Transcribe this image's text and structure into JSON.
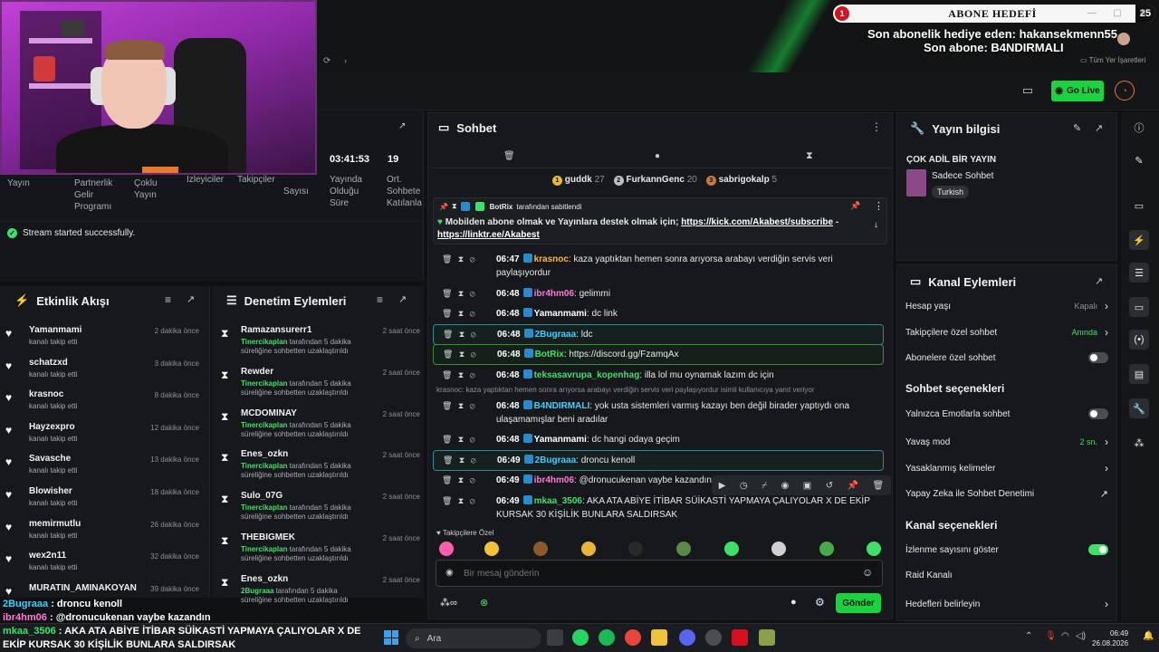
{
  "overlay": {
    "goal_title": "ABONE HEDEFİ",
    "goal_current": "1",
    "goal_target": "25",
    "last_gift": "Son abonelik hediye eden: hakansekmenn55",
    "last_sub": "Son abone: B4NDIRMALI",
    "bookmarks": "Tüm Yer İşaretleri"
  },
  "navbar": {
    "go_live": "Go Live"
  },
  "stats": {
    "time_value": "03:41:53",
    "count_value": "19",
    "labels": [
      "Yayın",
      "Partnerlik Gelir Programı",
      "Çoklu Yayın",
      "İzleyiciler",
      "Takipçiler",
      "Sayısı",
      "Yayında Olduğu Süre",
      "Ort. Sohbete Katılanla"
    ],
    "toast": "Stream started successfully."
  },
  "activity": {
    "title": "Etkinlik Akışı",
    "items": [
      {
        "name": "Yamanmami",
        "sub": "kanalı takip etti",
        "time": "2 dakika önce"
      },
      {
        "name": "schatzxd",
        "sub": "kanalı takip etti",
        "time": "3 dakika önce"
      },
      {
        "name": "krasnoc",
        "sub": "kanalı takip etti",
        "time": "8 dakika önce"
      },
      {
        "name": "Hayzexpro",
        "sub": "kanalı takip etti",
        "time": "12 dakika önce"
      },
      {
        "name": "Savasche",
        "sub": "kanalı takip etti",
        "time": "13 dakika önce"
      },
      {
        "name": "Blowisher",
        "sub": "kanalı takip etti",
        "time": "18 dakika önce"
      },
      {
        "name": "memirmutlu",
        "sub": "kanalı takip etti",
        "time": "26 dakika önce"
      },
      {
        "name": "wex2n11",
        "sub": "kanalı takip etti",
        "time": "32 dakika önce"
      },
      {
        "name": "MURATIN_AMINAKOYAN",
        "sub": "",
        "time": "39 dakika önce"
      }
    ]
  },
  "moderation": {
    "title": "Denetim Eylemleri",
    "items": [
      {
        "name": "Ramazansurerr1",
        "by": "Tinercikaplan",
        "action": "tarafından 5 dakika süreliğine sohbetten uzaklaştırıldı",
        "time": "2 saat önce"
      },
      {
        "name": "Rewder",
        "by": "Tinercikaplan",
        "action": "tarafından 5 dakika süreliğine sohbetten uzaklaştırıldı",
        "time": "2 saat önce"
      },
      {
        "name": "MCDOMINAY",
        "by": "Tinercikaplan",
        "action": "tarafından 5 dakika süreliğine sohbetten uzaklaştırıldı",
        "time": "2 saat önce"
      },
      {
        "name": "Enes_ozkn",
        "by": "Tinercikaplan",
        "action": "tarafından 5 dakika süreliğine sohbetten uzaklaştırıldı",
        "time": "2 saat önce"
      },
      {
        "name": "Sulo_07G",
        "by": "Tinercikaplan",
        "action": "tarafından 5 dakika süreliğine sohbetten uzaklaştırıldı",
        "time": "2 saat önce"
      },
      {
        "name": "THEBIGMEK",
        "by": "Tinercikaplan",
        "action": "tarafından 5 dakika süreliğine sohbetten uzaklaştırıldı",
        "time": "2 saat önce"
      },
      {
        "name": "Enes_ozkn",
        "by": "2Bugraaa",
        "action": "tarafından 5 dakika süreliğine sohbetten uzaklaştırıldı",
        "time": "2 saat önce"
      }
    ]
  },
  "overlay_chat": [
    {
      "name": "2Bugraaa",
      "sep": " : ",
      "text": "droncu kenoll",
      "color": "#3fd0ff"
    },
    {
      "name": "ibr4hm06",
      "sep": " : ",
      "text": "@dronucukenan vaybe kazandın",
      "color": "#ff79d9"
    },
    {
      "name": "mkaa_3506",
      "sep": " : ",
      "text": "AKA ATA ABİYE İTİBAR SÜİKASTİ YAPMAYA ÇALIYOLAR X DE",
      "color": "#3fe06a"
    },
    {
      "name": "",
      "sep": "",
      "text": "EKİP KURSAK 30 KİŞİLİK BUNLARA SALDIRSAK",
      "color": "#ffffff"
    }
  ],
  "chat": {
    "title": "Sohbet",
    "gifters": [
      {
        "rank": "1",
        "name": "guddk",
        "count": "27"
      },
      {
        "rank": "2",
        "name": "FurkannGenc",
        "count": "20"
      },
      {
        "rank": "3",
        "name": "sabrigokalp",
        "count": "5"
      }
    ],
    "pinned": {
      "by": "BotRix",
      "by_suffix": "tarafından sabitlendi",
      "text": "Mobilden abone olmak ve Yayınlara destek olmak için;",
      "link1": "https://kick.com/Akabest/subscribe",
      "dash": "-",
      "link2": "https://linktr.ee/Akabest"
    },
    "messages": [
      {
        "time": "06:47",
        "name": "krasnoc",
        "color": "#ffb640",
        "text": "kaza yaptıktan hemen sonra arıyorsa arabayı verdiğin servis veri paylaşıyordur",
        "hl": ""
      },
      {
        "time": "06:48",
        "name": "ibr4hm06",
        "color": "#ff79d9",
        "text": "gelimmi",
        "hl": ""
      },
      {
        "time": "06:48",
        "name": "Yamanmami",
        "color": "#ffffff",
        "text": "dc link",
        "hl": ""
      },
      {
        "time": "06:48",
        "name": "2Bugraaa",
        "color": "#3fd0ff",
        "text": "ldc",
        "hl": "blue"
      },
      {
        "time": "06:48",
        "name": "BotRix",
        "color": "#3fe06a",
        "text": "https://discord.gg/FzamqAx",
        "hl": "green"
      },
      {
        "time": "06:48",
        "name": "teksasavrupa_kopenhag",
        "color": "#3fe06a",
        "text": "illa lol mu oynamak lazım dc için",
        "hl": ""
      },
      {
        "time": "06:48",
        "name": "B4NDIRMALI",
        "color": "#3fd0ff",
        "text": "yok usta sistemleri varmış kazayı ben değil birader yaptıydı ona ulaşamamışlar beni aradılar",
        "hl": ""
      },
      {
        "time": "06:48",
        "name": "Yamanmami",
        "color": "#ffffff",
        "text": "dc hangi odaya geçim",
        "hl": ""
      },
      {
        "time": "06:49",
        "name": "2Bugraaa",
        "color": "#3fd0ff",
        "text": "droncu kenoll",
        "hl": "blue"
      },
      {
        "time": "06:49",
        "name": "ibr4hm06",
        "color": "#ff79d9",
        "text": "@dronucukenan vaybe kazandın",
        "hl": ""
      },
      {
        "time": "06:49",
        "name": "mkaa_3506",
        "color": "#3fe06a",
        "text": "AKA ATA ABİYE İTİBAR SÜİKASTİ YAPMAYA ÇALIYOLAR X DE EKİP KURSAK 30 KİŞİLİK BUNLARA SALDIRSAK",
        "hl": ""
      }
    ],
    "reply_hint_1": "krasnoc: kaza yaptıktan hemen sonra arıyorsa arabayı verdiğin servis veri paylaşıyordur isimli kullanıcıya yanıt veriyor",
    "followers_only": "Takipçilere Özel",
    "input_placeholder": "Bir mesaj gönderin",
    "send": "Gönder"
  },
  "stream_info": {
    "title": "Yayın bilgisi",
    "stream_title": "ÇOK ADİL BİR YAYIN",
    "category": "Sadece Sohbet",
    "language": "Turkish"
  },
  "channel_actions": {
    "title": "Kanal Eylemleri",
    "rows": [
      {
        "label": "Hesap yaşı",
        "value": "Kapalı"
      },
      {
        "label": "Takipçilere özel sohbet",
        "value": "Anında"
      },
      {
        "label": "Abonelere özel sohbet",
        "value": ""
      }
    ],
    "chat_heading": "Sohbet seçenekleri",
    "chat_rows": [
      {
        "label": "Yalnızca Emotlarla sohbet",
        "value": ""
      },
      {
        "label": "Yavaş mod",
        "value": "2 sn."
      },
      {
        "label": "Yasaklanmış kelimeler",
        "value": ""
      },
      {
        "label": "Yapay Zeka ile Sohbet Denetimi",
        "value": ""
      }
    ],
    "channel_heading": "Kanal seçenekleri",
    "channel_rows": [
      {
        "label": "İzlenme sayısını göster",
        "value": ""
      },
      {
        "label": "Raid Kanalı",
        "value": ""
      },
      {
        "label": "Hedefleri belirleyin",
        "value": ""
      }
    ]
  },
  "taskbar": {
    "search": "Ara",
    "time": "06:49",
    "date": "26.08.2026"
  },
  "colors": {
    "accent": "#19d33f",
    "panel": "#16181b",
    "background": "#0f1113"
  }
}
